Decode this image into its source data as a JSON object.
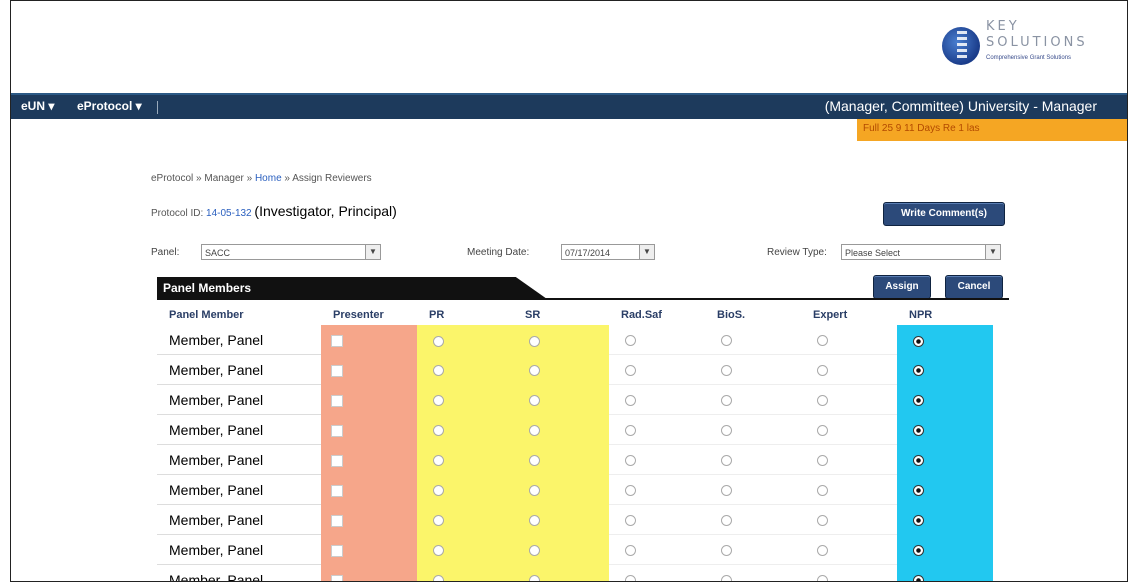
{
  "logo": {
    "line1": "KEY",
    "line2": "SOLUTIONS",
    "tagline": "Comprehensive Grant Solutions"
  },
  "nav": {
    "item1": "eUN ▾",
    "item2": "eProtocol ▾"
  },
  "user": "(Manager, Committee) University - Manager",
  "banner": "Full 25 9 11 Days Re 1 las",
  "breadcrumb": {
    "part1": "eProtocol » Manager »",
    "link": "Home",
    "part2": "» Assign Reviewers"
  },
  "protocol": {
    "label": "Protocol ID:",
    "id": "14-05-132",
    "investigator": "(Investigator, Principal)"
  },
  "buttons": {
    "write_comments": "Write Comment(s)",
    "assign": "Assign",
    "cancel": "Cancel"
  },
  "filters": {
    "panel_label": "Panel:",
    "panel_value": "SACC",
    "meeting_label": "Meeting Date:",
    "meeting_value": "07/17/2014",
    "review_label": "Review Type:",
    "review_value": "Please Select"
  },
  "section_title": "Panel Members",
  "table": {
    "headers": [
      "Panel Member",
      "Presenter",
      "PR",
      "SR",
      "Rad.Saf",
      "BioS.",
      "Expert",
      "NPR"
    ],
    "rows": [
      {
        "name": "Member, Panel"
      },
      {
        "name": "Member, Panel"
      },
      {
        "name": "Member, Panel"
      },
      {
        "name": "Member, Panel"
      },
      {
        "name": "Member, Panel"
      },
      {
        "name": "Member, Panel"
      },
      {
        "name": "Member, Panel"
      },
      {
        "name": "Member, Panel"
      },
      {
        "name": "Member, Panel"
      }
    ]
  },
  "colors": {
    "navbar": "#1d3a5c",
    "banner": "#f5a623",
    "presenter_col": "#f6a68a",
    "reviewer_col": "#fbf56a",
    "npr_col": "#22c8f0"
  }
}
